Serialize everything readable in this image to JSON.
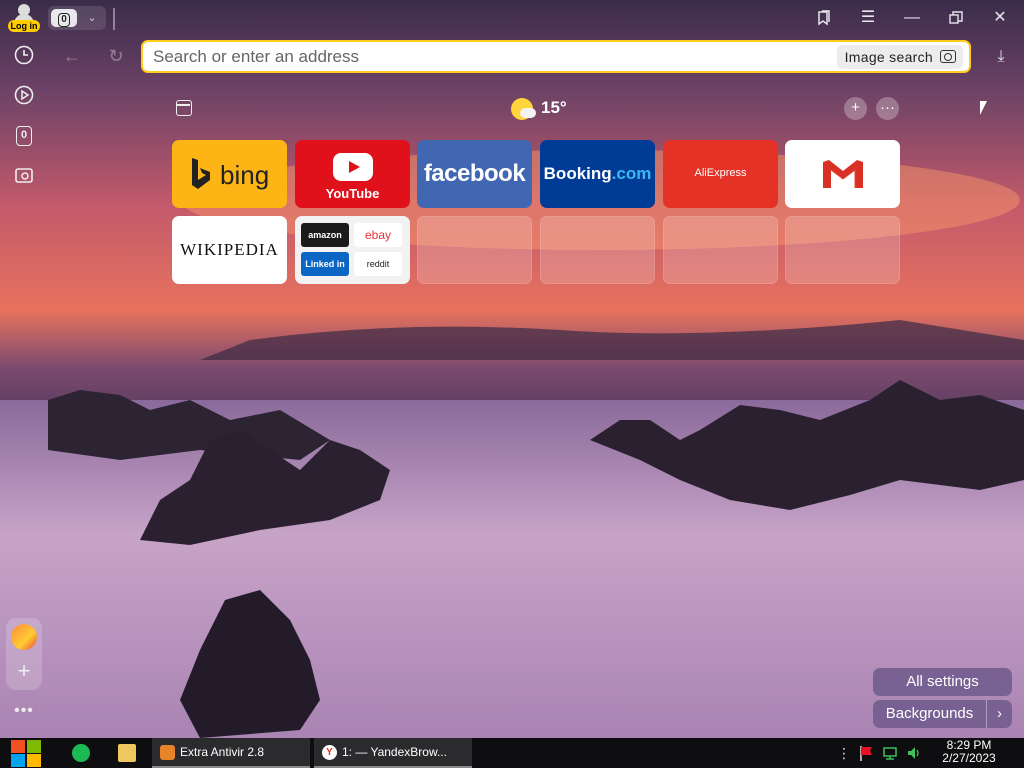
{
  "profile": {
    "login_label": "Log in"
  },
  "tabs": {
    "count": "0"
  },
  "address_bar": {
    "placeholder": "Search or enter an address",
    "value": "",
    "image_search_label": "Image search"
  },
  "weather": {
    "temperature": "15°"
  },
  "sidebar": {
    "tabs_label": "0"
  },
  "tiles": [
    {
      "name": "bing",
      "label": "bing"
    },
    {
      "name": "youtube",
      "label": "YouTube"
    },
    {
      "name": "facebook",
      "label": "facebook"
    },
    {
      "name": "booking",
      "label": "Booking",
      "suffix": ".com"
    },
    {
      "name": "aliexpress",
      "label": "AliExpress"
    },
    {
      "name": "gmail",
      "label": ""
    },
    {
      "name": "wikipedia",
      "label": "Wikipedia"
    },
    {
      "name": "multi",
      "items": [
        "amazon",
        "ebay",
        "Linked in",
        "reddit"
      ]
    }
  ],
  "settings": {
    "all_settings": "All settings",
    "backgrounds": "Backgrounds"
  },
  "taskbar": {
    "items": [
      {
        "label": "Extra Antivir 2.8"
      },
      {
        "label": "1: — YandexBrow..."
      }
    ],
    "time": "8:29 PM",
    "date": "2/27/2023"
  },
  "colors": {
    "accent": "#ffcc1a",
    "youtube": "#e0111b",
    "facebook": "#4267b2",
    "booking": "#003b95",
    "bing": "#fdb515",
    "aliexpress": "#e43226"
  }
}
